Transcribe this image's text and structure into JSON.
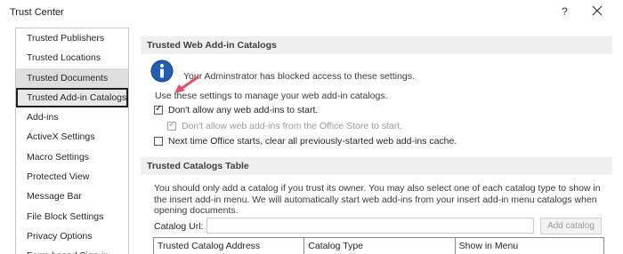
{
  "window": {
    "title": "Trust Center",
    "help_glyph": "?"
  },
  "sidebar": {
    "items": [
      {
        "label": "Trusted Publishers"
      },
      {
        "label": "Trusted Locations"
      },
      {
        "label": "Trusted Documents"
      },
      {
        "label": "Trusted Add-in Catalogs"
      },
      {
        "label": "Add-ins"
      },
      {
        "label": "ActiveX Settings"
      },
      {
        "label": "Macro Settings"
      },
      {
        "label": "Protected View"
      },
      {
        "label": "Message Bar"
      },
      {
        "label": "File Block Settings"
      },
      {
        "label": "Privacy Options"
      },
      {
        "label": "Form-based Sign-in"
      }
    ],
    "selected_index": 3
  },
  "web_catalogs": {
    "header": "Trusted Web Add-in Catalogs",
    "blocked_notice": "Your Adminstrator has blocked access to these settings.",
    "instructions": "Use these settings to manage your web add-in catalogs.",
    "options": [
      {
        "label": "Don't allow any web add-ins to start.",
        "checked": true
      },
      {
        "label": "Don't allow web add-ins from the Office Store to start.",
        "checked": true,
        "disabled": true
      },
      {
        "label": "Next time Office starts, clear all previously-started web add-ins cache.",
        "checked": false
      }
    ]
  },
  "catalogs_table": {
    "header": "Trusted Catalogs Table",
    "description": "You should only add a catalog if you trust its owner. You may also select one of each catalog type to show in the insert add-in menu. We will automatically start web add-ins from your insert add-in menu catalogs when opening documents.",
    "url_label": "Catalog Url:",
    "url_value": "",
    "add_button": "Add catalog",
    "columns": [
      "Trusted Catalog Address",
      "Catalog Type",
      "Show in Menu"
    ]
  },
  "colors": {
    "selected_border": "#1f1f1f",
    "section_bg": "#efefef",
    "info_blue": "#1f5fb5",
    "annotation_arrow": "#e0506a"
  }
}
